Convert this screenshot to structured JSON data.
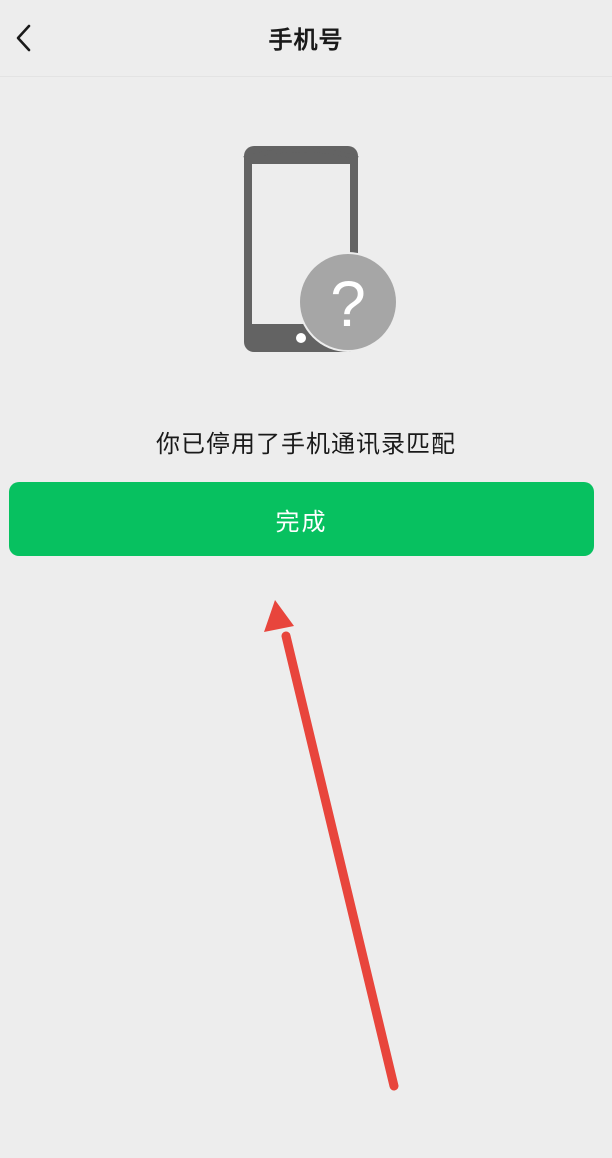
{
  "header": {
    "title": "手机号",
    "back_icon": "chevron-left-icon"
  },
  "illustration": {
    "icon": "phone-with-question-mark-icon",
    "badge_glyph": "?"
  },
  "main": {
    "status_text": "你已停用了手机通讯录匹配",
    "done_label": "完成"
  },
  "annotation": {
    "icon": "red-arrow-pointing-up",
    "color": "#e8453c"
  },
  "colors": {
    "accent": "#07c160",
    "background": "#ededed",
    "phone": "#636363",
    "badge": "#a6a6a6"
  }
}
